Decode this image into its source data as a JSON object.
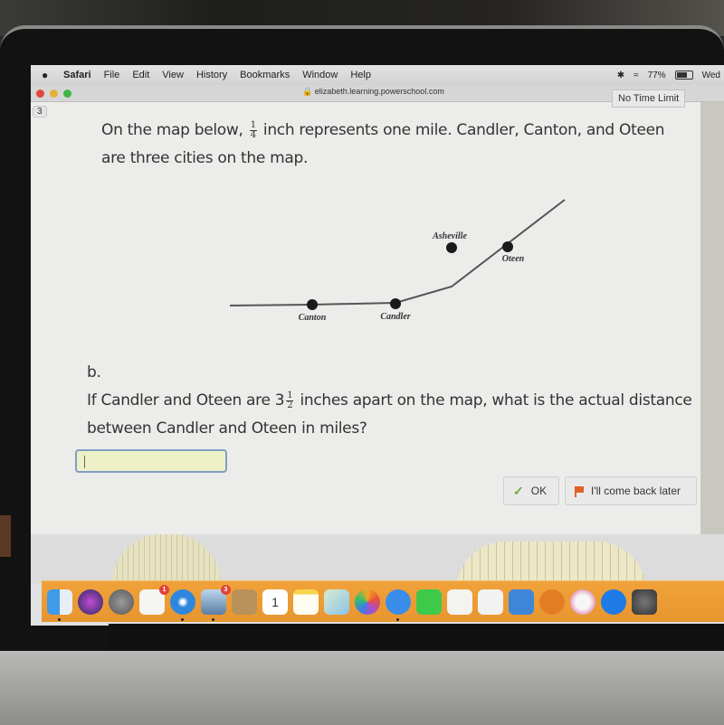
{
  "menubar": {
    "app": "Safari",
    "items": [
      "File",
      "Edit",
      "View",
      "History",
      "Bookmarks",
      "Window",
      "Help"
    ],
    "battery": "77%",
    "battery_level": 0.77,
    "clock": "Wed"
  },
  "browser": {
    "url": "elizabeth.learning.powerschool.com"
  },
  "question": {
    "number": "3",
    "time_limit": "No Time Limit",
    "prompt_before": "On the map below,",
    "scale_num": "1",
    "scale_den": "4",
    "prompt_after": "inch represents one mile. Candler, Canton, and Oteen are three cities on the map.",
    "part_label": "b.",
    "part_before": "If Candler and Oteen are 3",
    "mixed_num": "1",
    "mixed_den": "2",
    "part_after": "inches apart on the map, what is the actual distance between Candler and Oteen in miles?",
    "answer_value": ""
  },
  "map": {
    "cities": [
      {
        "name": "Canton"
      },
      {
        "name": "Candler"
      },
      {
        "name": "Asheville"
      },
      {
        "name": "Oteen"
      }
    ]
  },
  "buttons": {
    "ok": "OK",
    "later": "I'll come back later"
  },
  "dock": {
    "apps": [
      {
        "name": "Finder",
        "icon": "finder-icon"
      },
      {
        "name": "Siri",
        "icon": "siri-icon"
      },
      {
        "name": "Launchpad",
        "icon": "launchpad-icon"
      },
      {
        "name": "Reminders",
        "icon": "reminders-icon",
        "badge": "1"
      },
      {
        "name": "Safari",
        "icon": "safari-icon"
      },
      {
        "name": "Preview",
        "icon": "preview-icon",
        "badge": "3"
      },
      {
        "name": "Contacts",
        "icon": "contacts-icon"
      },
      {
        "name": "Calendar",
        "icon": "calendar-icon",
        "date": "1"
      },
      {
        "name": "Notes",
        "icon": "notes-icon"
      },
      {
        "name": "Maps",
        "icon": "maps-icon"
      },
      {
        "name": "Photos",
        "icon": "photos-icon"
      },
      {
        "name": "Messages",
        "icon": "messages-icon"
      },
      {
        "name": "FaceTime",
        "icon": "facetime-icon"
      },
      {
        "name": "Pages",
        "icon": "pages-icon"
      },
      {
        "name": "Numbers",
        "icon": "numbers-icon"
      },
      {
        "name": "Keynote",
        "icon": "keynote-icon"
      },
      {
        "name": "Books",
        "icon": "books-icon"
      },
      {
        "name": "iTunes",
        "icon": "itunes-icon"
      },
      {
        "name": "App Store",
        "icon": "app-store-icon"
      },
      {
        "name": "System Preferences",
        "icon": "system-preferences-icon"
      }
    ]
  }
}
